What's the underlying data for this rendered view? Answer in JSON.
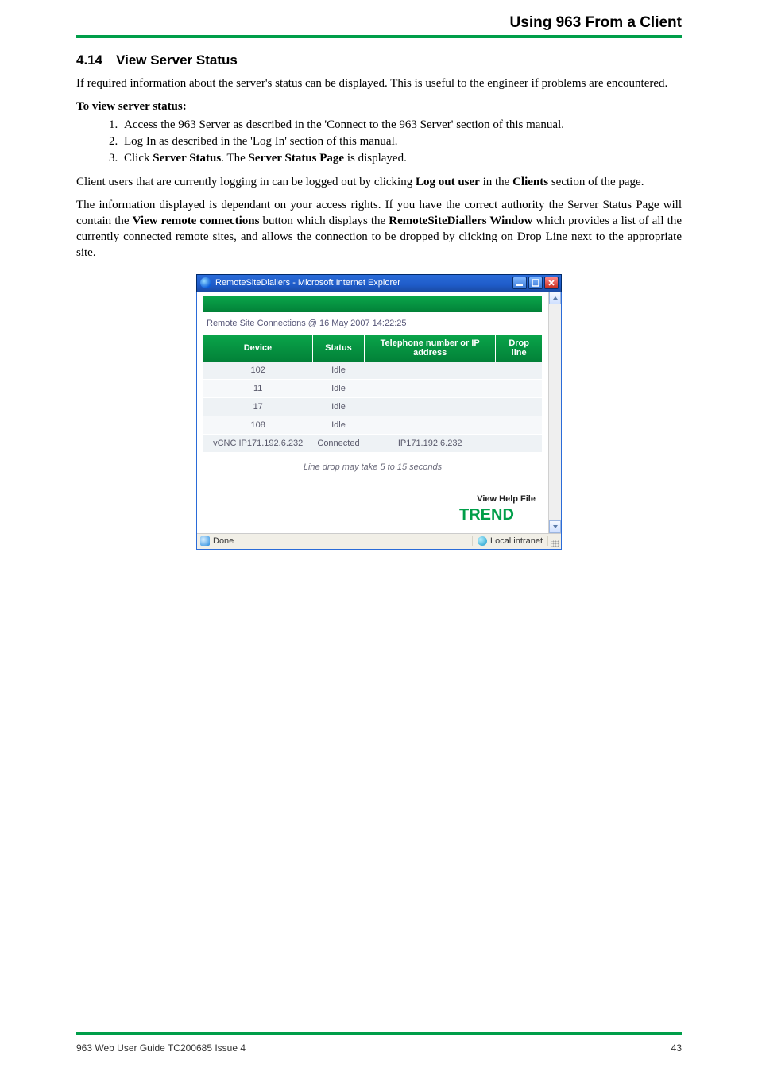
{
  "header": {
    "section_title": "Using 963 From a Client"
  },
  "heading": "4.14 View Server Status",
  "intro": "If required information about the server's status can be displayed. This is useful to the engineer if problems are encountered.",
  "list": {
    "intro": "To view server status:",
    "items": [
      {
        "prefix": "Access the 963 Server as described in the 'Connect to the 963 Server' section of this manual."
      },
      {
        "prefix": "Log In as described in the 'Log In' section of this manual."
      },
      {
        "html_prefix": "Click ",
        "bold1": "Server Status",
        "mid": ". The ",
        "bold2": "Server Status Page",
        "suffix": " is displayed."
      }
    ]
  },
  "para2": {
    "a": "Client users that are currently logging in can be logged out by clicking ",
    "b": "Log out user",
    "c": " in the ",
    "d": "Clients",
    "e": " section of the page."
  },
  "para3": {
    "a": "The information displayed is dependant on your access rights. If you have the correct authority the Server Status Page will contain the ",
    "b": "View remote connections",
    "c": " button which displays the ",
    "d": "RemoteSiteDiallers Window",
    "e": " which provides a list of all the currently connected remote sites, and allows the connection to be dropped by clicking on Drop Line next to the appropriate site."
  },
  "window": {
    "title": "RemoteSiteDiallers - Microsoft Internet Explorer",
    "remote_label": "Remote Site Connections @ 16 May 2007 14:22:25",
    "columns": {
      "device": "Device",
      "status": "Status",
      "tel": "Telephone number or IP address",
      "drop": "Drop line"
    },
    "rows": [
      {
        "device": "102",
        "status": "Idle",
        "tel": "",
        "drop": ""
      },
      {
        "device": "11",
        "status": "Idle",
        "tel": "",
        "drop": ""
      },
      {
        "device": "17",
        "status": "Idle",
        "tel": "",
        "drop": ""
      },
      {
        "device": "108",
        "status": "Idle",
        "tel": "",
        "drop": ""
      },
      {
        "device": "vCNC IP171.192.6.232",
        "status": "Connected",
        "tel": "IP171.192.6.232",
        "drop": ""
      }
    ],
    "dropnote": "Line drop may take 5 to 15 seconds",
    "helpfile": "View Help File",
    "status_done": "Done",
    "status_zone": "Local intranet"
  },
  "footer": {
    "left": "963 Web User Guide TC200685 Issue 4",
    "right": "43"
  },
  "icons": {
    "ie": "ie-icon",
    "min": "minimize-icon",
    "max": "maximize-icon",
    "close": "close-icon",
    "up": "scroll-up-icon",
    "down": "scroll-down-icon",
    "done": "done-icon",
    "intranet": "intranet-icon",
    "grip": "resize-grip-icon"
  }
}
